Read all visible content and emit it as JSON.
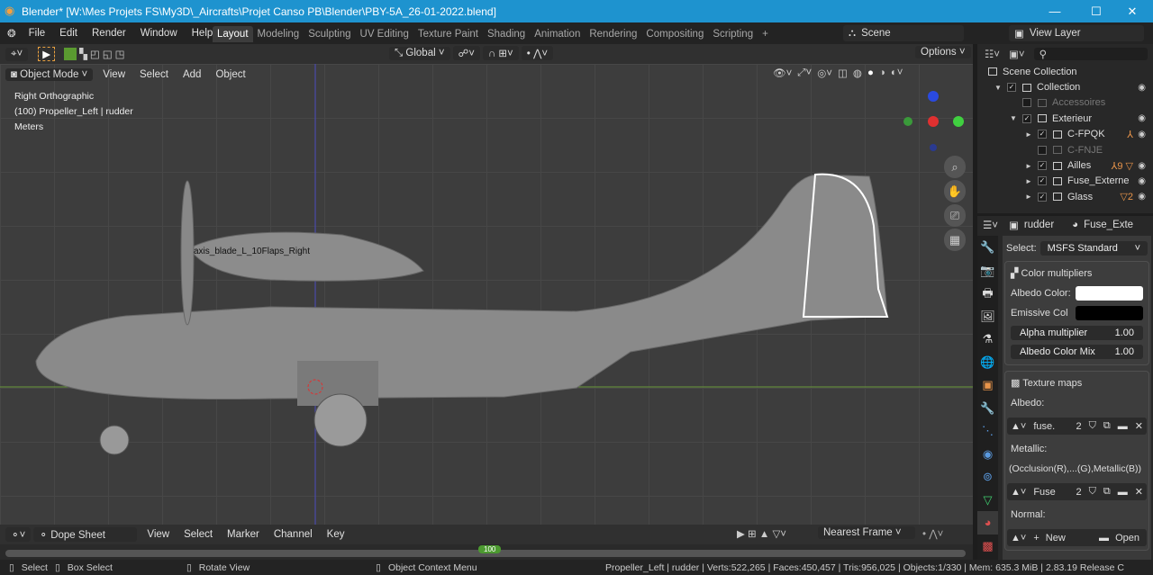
{
  "window": {
    "title": "Blender* [W:\\Mes Projets FS\\My3D\\_Aircrafts\\Projet Canso PB\\Blender\\PBY-5A_26-01-2022.blend]",
    "minimize": "—",
    "maximize": "☐",
    "close": "✕"
  },
  "menu": [
    "File",
    "Edit",
    "Render",
    "Window",
    "Help"
  ],
  "workspaces": [
    {
      "label": "Layout",
      "active": true
    },
    {
      "label": "Modeling"
    },
    {
      "label": "Sculpting"
    },
    {
      "label": "UV Editing"
    },
    {
      "label": "Texture Paint"
    },
    {
      "label": "Shading"
    },
    {
      "label": "Animation"
    },
    {
      "label": "Rendering"
    },
    {
      "label": "Compositing"
    },
    {
      "label": "Scripting"
    }
  ],
  "add_workspace": "+",
  "scene": {
    "label": "Scene",
    "view_layer": "View Layer"
  },
  "tool_header": {
    "orientation": "Global",
    "options": "Options"
  },
  "viewport": {
    "mode": "Object Mode",
    "menus": [
      "View",
      "Select",
      "Add",
      "Object"
    ],
    "view_name": "Right Orthographic",
    "object_info": "(100) Propeller_Left | rudder",
    "units": "Meters",
    "overlay_label": "axis_blade_L_10Flaps_Right"
  },
  "outliner": {
    "items": [
      {
        "label": "Scene Collection",
        "depth": 0,
        "checked": null
      },
      {
        "label": "Collection",
        "depth": 1,
        "checked": true,
        "expand": "▼"
      },
      {
        "label": "Accessoires",
        "depth": 2,
        "checked": false,
        "disabled": true
      },
      {
        "label": "Exterieur",
        "depth": 2,
        "checked": true,
        "expand": "▼"
      },
      {
        "label": "C-FPQK",
        "depth": 3,
        "checked": true,
        "expand": "►",
        "extra": "⅄"
      },
      {
        "label": "C-FNJE",
        "depth": 3,
        "checked": false,
        "disabled": true
      },
      {
        "label": "Ailles",
        "depth": 3,
        "checked": true,
        "expand": "►",
        "extra": "⅄9 ▽"
      },
      {
        "label": "Fuse_Externe",
        "depth": 3,
        "checked": true,
        "expand": "►"
      },
      {
        "label": "Glass",
        "depth": 3,
        "checked": true,
        "expand": "►",
        "extra": "▽2"
      }
    ]
  },
  "properties": {
    "object": "rudder",
    "material": "Fuse_Exte",
    "select_label": "Select:",
    "select_value": "MSFS Standard",
    "color_multipliers": "Color multipliers",
    "albedo_color_label": "Albedo Color:",
    "albedo_color": "#ffffff",
    "emissive_label": "Emissive Col",
    "emissive_color": "#000000",
    "alpha_label": "Alpha multiplier",
    "alpha_value": "1.00",
    "mix_label": "Albedo Color Mix",
    "mix_value": "1.00",
    "texture_maps": "Texture maps",
    "albedo_label": "Albedo:",
    "albedo_tex": "fuse.",
    "albedo_users": "2",
    "metallic_label": "Metallic:",
    "metallic_desc": "(Occlusion(R),...(G),Metallic(B))",
    "metallic_tex": "Fuse",
    "metallic_users": "2",
    "normal_label": "Normal:",
    "new_label": "New",
    "open_label": "Open"
  },
  "dopesheet": {
    "editor": "Dope Sheet",
    "menus": [
      "View",
      "Select",
      "Marker",
      "Channel",
      "Key"
    ],
    "snap": "Nearest Frame",
    "current_frame": "100"
  },
  "status": {
    "select": "Select",
    "box_select": "Box Select",
    "rotate": "Rotate View",
    "context": "Object Context Menu",
    "stats": "Propeller_Left | rudder | Verts:522,265 | Faces:450,457 | Tris:956,025 | Objects:1/330 | Mem: 635.3 MiB | 2.83.19 Release C"
  },
  "colors": {
    "accent": "#4772b3",
    "title_bar": "#1e93cf",
    "selection": "#ffffff",
    "outliner_icon": "#e8944a"
  }
}
